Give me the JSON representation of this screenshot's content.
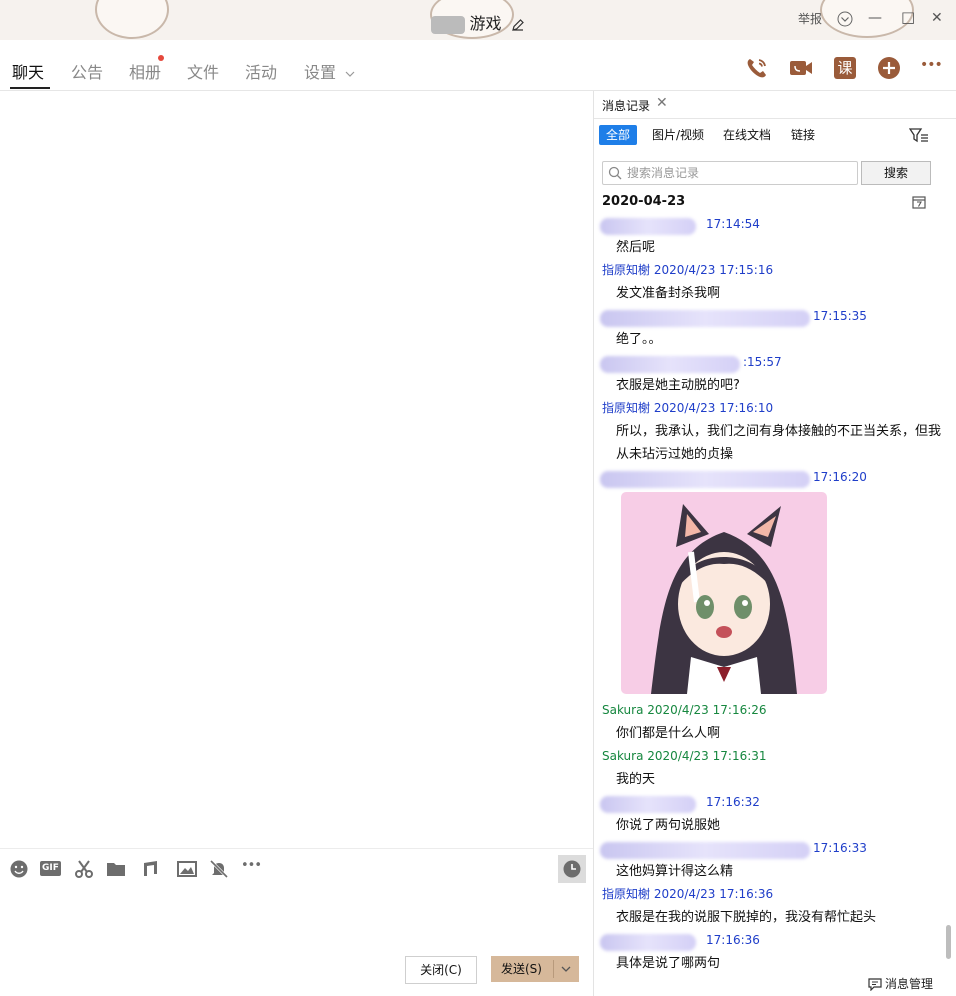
{
  "window": {
    "title": "游戏",
    "report_label": "举报",
    "minimize_glyph": "—",
    "maximize_glyph": "□",
    "close_glyph": "✕",
    "colors": {
      "accent": "#1e7ee8",
      "brand": "#9a5b3a"
    }
  },
  "tabs": [
    {
      "label": "聊天"
    },
    {
      "label": "公告"
    },
    {
      "label": "相册"
    },
    {
      "label": "文件"
    },
    {
      "label": "活动"
    },
    {
      "label": "设置"
    }
  ],
  "header_icons": [
    "phone-icon",
    "video-call-icon",
    "course-icon",
    "add-circle-icon",
    "more-icon"
  ],
  "course_icon_text": "课",
  "more_glyph": "•••",
  "toolbar_icons": [
    "emoji-icon",
    "gif-icon",
    "scissors-icon",
    "folder-icon",
    "music-icon",
    "image-icon",
    "mute-bell-icon",
    "more-icon",
    "history-clock-icon"
  ],
  "gif_text": "GIF",
  "toolbar_more_glyph": "•••",
  "buttons": {
    "close_label": "关闭(C)",
    "send_label": "发送(S)"
  },
  "history_panel": {
    "tab_label": "消息记录",
    "filters": [
      "全部",
      "图片/视频",
      "在线文档",
      "链接"
    ],
    "search_placeholder": "搜索消息记录",
    "search_button": "搜索",
    "date": "2020-04-23",
    "manage_label": "消息管理",
    "messages": [
      {
        "sender": "",
        "time": "17:14:54",
        "text": "然后呢"
      },
      {
        "sender": "指原知榭",
        "time": "2020/4/23 17:15:16",
        "text": "发文准备封杀我啊"
      },
      {
        "sender": "",
        "time": "17:15:35",
        "text": "绝了。。"
      },
      {
        "sender": "",
        "time": ":15:57",
        "text": "衣服是她主动脱的吧?"
      },
      {
        "sender": "指原知榭",
        "time": "2020/4/23 17:16:10",
        "text": "所以，我承认，我们之间有身体接触的不正当关系，但我从未玷污过她的贞操"
      },
      {
        "sender": "",
        "time": "17:16:20",
        "text": ""
      },
      {
        "sender": "Sakura",
        "time": "2020/4/23 17:16:26",
        "text": "你们都是什么人啊"
      },
      {
        "sender": "Sakura",
        "time": "2020/4/23 17:16:31",
        "text": "我的天"
      },
      {
        "sender": "",
        "time": "17:16:32",
        "text": "你说了两句说服她"
      },
      {
        "sender": "",
        "time": "17:16:33",
        "text": "这他妈算计得这么精"
      },
      {
        "sender": "指原知榭",
        "time": "2020/4/23 17:16:36",
        "text": "衣服是在我的说服下脱掉的，我没有帮忙起头"
      },
      {
        "sender": "",
        "time": "17:16:36",
        "text": "具体是说了哪两句"
      }
    ]
  }
}
